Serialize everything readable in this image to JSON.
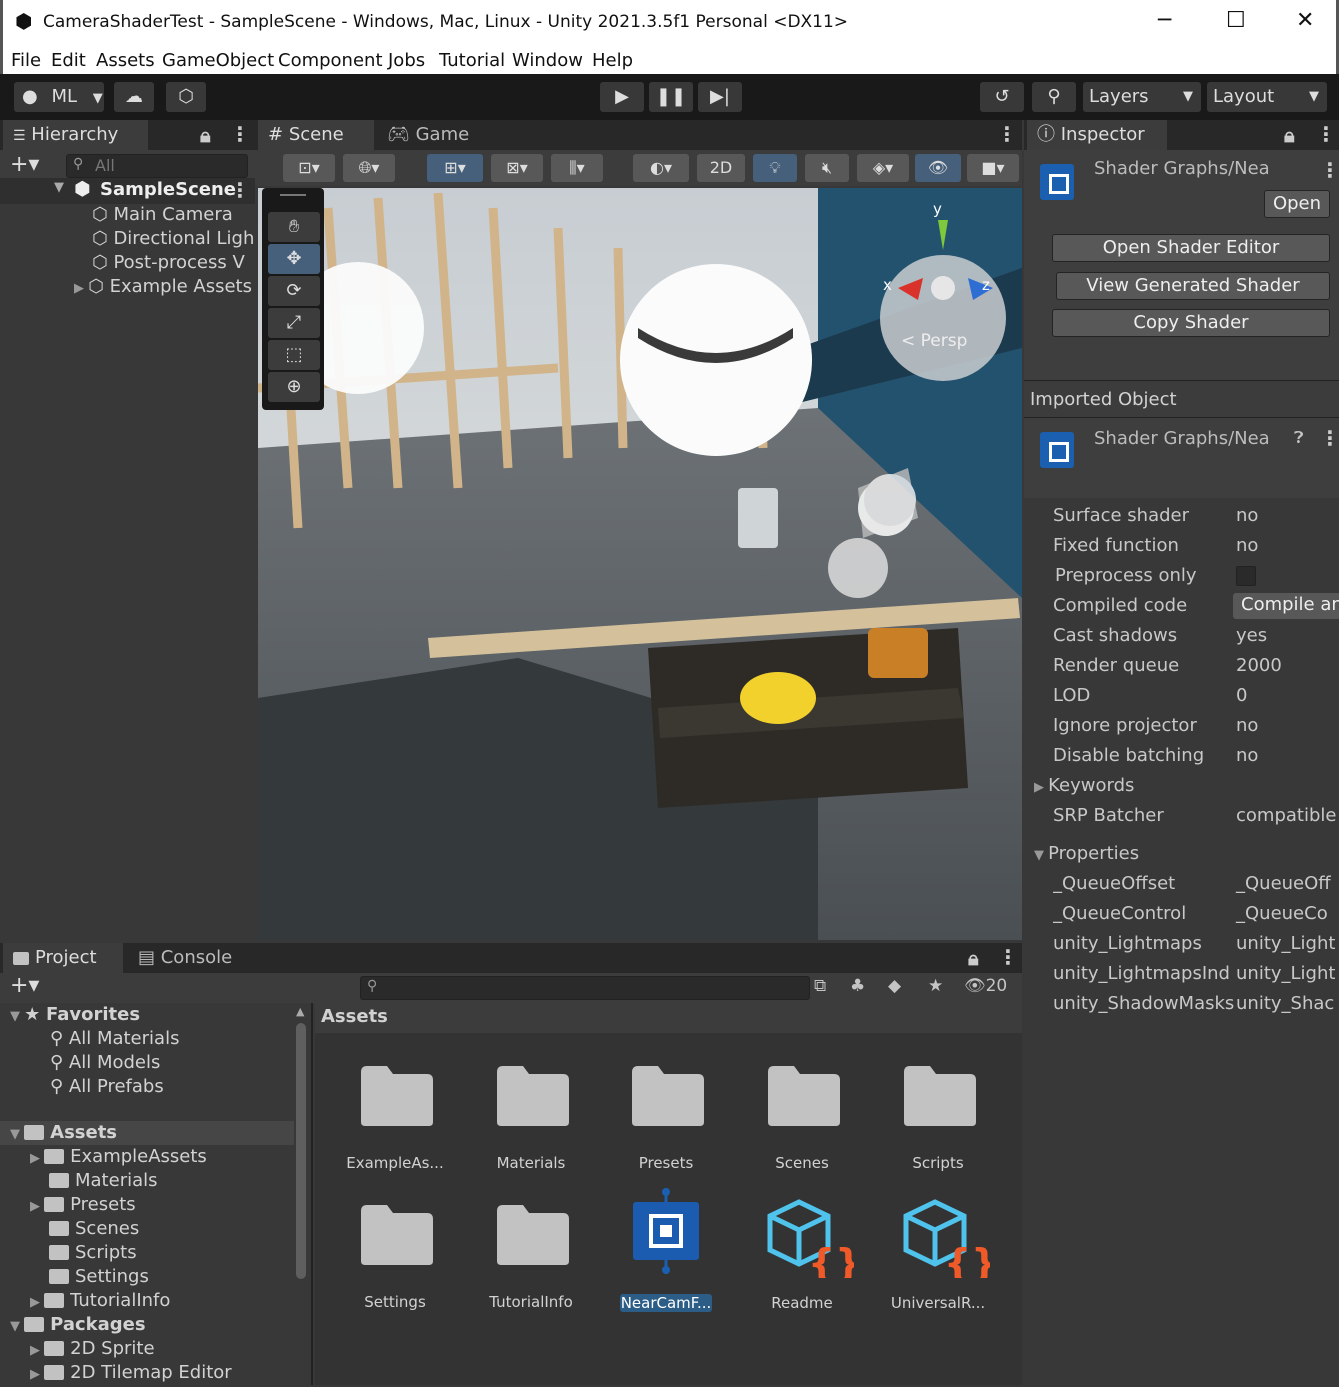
{
  "window": {
    "title": "CameraShaderTest - SampleScene - Windows, Mac, Linux - Unity 2021.3.5f1 Personal <DX11>",
    "minimize": "─",
    "maximize": "☐",
    "close": "✕"
  },
  "menu": [
    "File",
    "Edit",
    "Assets",
    "GameObject",
    "Component",
    "Jobs",
    "Tutorial",
    "Window",
    "Help"
  ],
  "toolbar": {
    "account": "ML",
    "layers": "Layers",
    "layout": "Layout"
  },
  "hierarchy": {
    "tab": "Hierarchy",
    "search_placeholder": "All",
    "scene": "SampleScene",
    "items": [
      "Main Camera",
      "Directional Ligh",
      "Post-process V",
      "Example Assets"
    ]
  },
  "scene": {
    "tabs": [
      "Scene",
      "Game"
    ],
    "mode_2d": "2D",
    "gizmo": {
      "y": "y",
      "x": "x",
      "z": "z",
      "persp": "< Persp"
    }
  },
  "inspector": {
    "tab": "Inspector",
    "asset_title": "Shader Graphs/Nea",
    "open": "Open",
    "buttons": [
      "Open Shader Editor",
      "View Generated Shader",
      "Copy Shader"
    ],
    "imported_header": "Imported Object",
    "imported_title": "Shader Graphs/Nea",
    "properties": [
      {
        "k": "Surface shader",
        "v": "no"
      },
      {
        "k": "Fixed function",
        "v": "no"
      },
      {
        "k": "Preprocess only",
        "v": ""
      },
      {
        "k": "Compiled code",
        "v": "Compile an"
      },
      {
        "k": "Cast shadows",
        "v": "yes"
      },
      {
        "k": "Render queue",
        "v": "2000"
      },
      {
        "k": "LOD",
        "v": "0"
      },
      {
        "k": "Ignore projector",
        "v": "no"
      },
      {
        "k": "Disable batching",
        "v": "no"
      }
    ],
    "keywords": "Keywords",
    "srp": {
      "k": "SRP Batcher",
      "v": "compatible"
    },
    "properties_header": "Properties",
    "props": [
      {
        "k": "_QueueOffset",
        "v": "_QueueOff"
      },
      {
        "k": "_QueueControl",
        "v": "_QueueCo"
      },
      {
        "k": "unity_Lightmaps",
        "v": "unity_Light"
      },
      {
        "k": "unity_LightmapsInd",
        "v": "unity_Light"
      },
      {
        "k": "unity_ShadowMasks",
        "v": "unity_Shac"
      }
    ]
  },
  "project": {
    "tabs": [
      "Project",
      "Console"
    ],
    "hidden_count": "20",
    "favorites": "Favorites",
    "fav_items": [
      "All Materials",
      "All Models",
      "All Prefabs"
    ],
    "assets_root": "Assets",
    "asset_folders": [
      "ExampleAssets",
      "Materials",
      "Presets",
      "Scenes",
      "Scripts",
      "Settings",
      "TutorialInfo"
    ],
    "packages_root": "Packages",
    "package_folders": [
      "2D Sprite",
      "2D Tilemap Editor"
    ],
    "breadcrumb": "Assets",
    "grid": [
      "ExampleAs...",
      "Materials",
      "Presets",
      "Scenes",
      "Scripts",
      "Settings",
      "TutorialInfo",
      "NearCamF...",
      "Readme",
      "UniversalR..."
    ]
  },
  "colors": {
    "accent": "#2c5d87",
    "selected_label": "#2c5d87"
  }
}
